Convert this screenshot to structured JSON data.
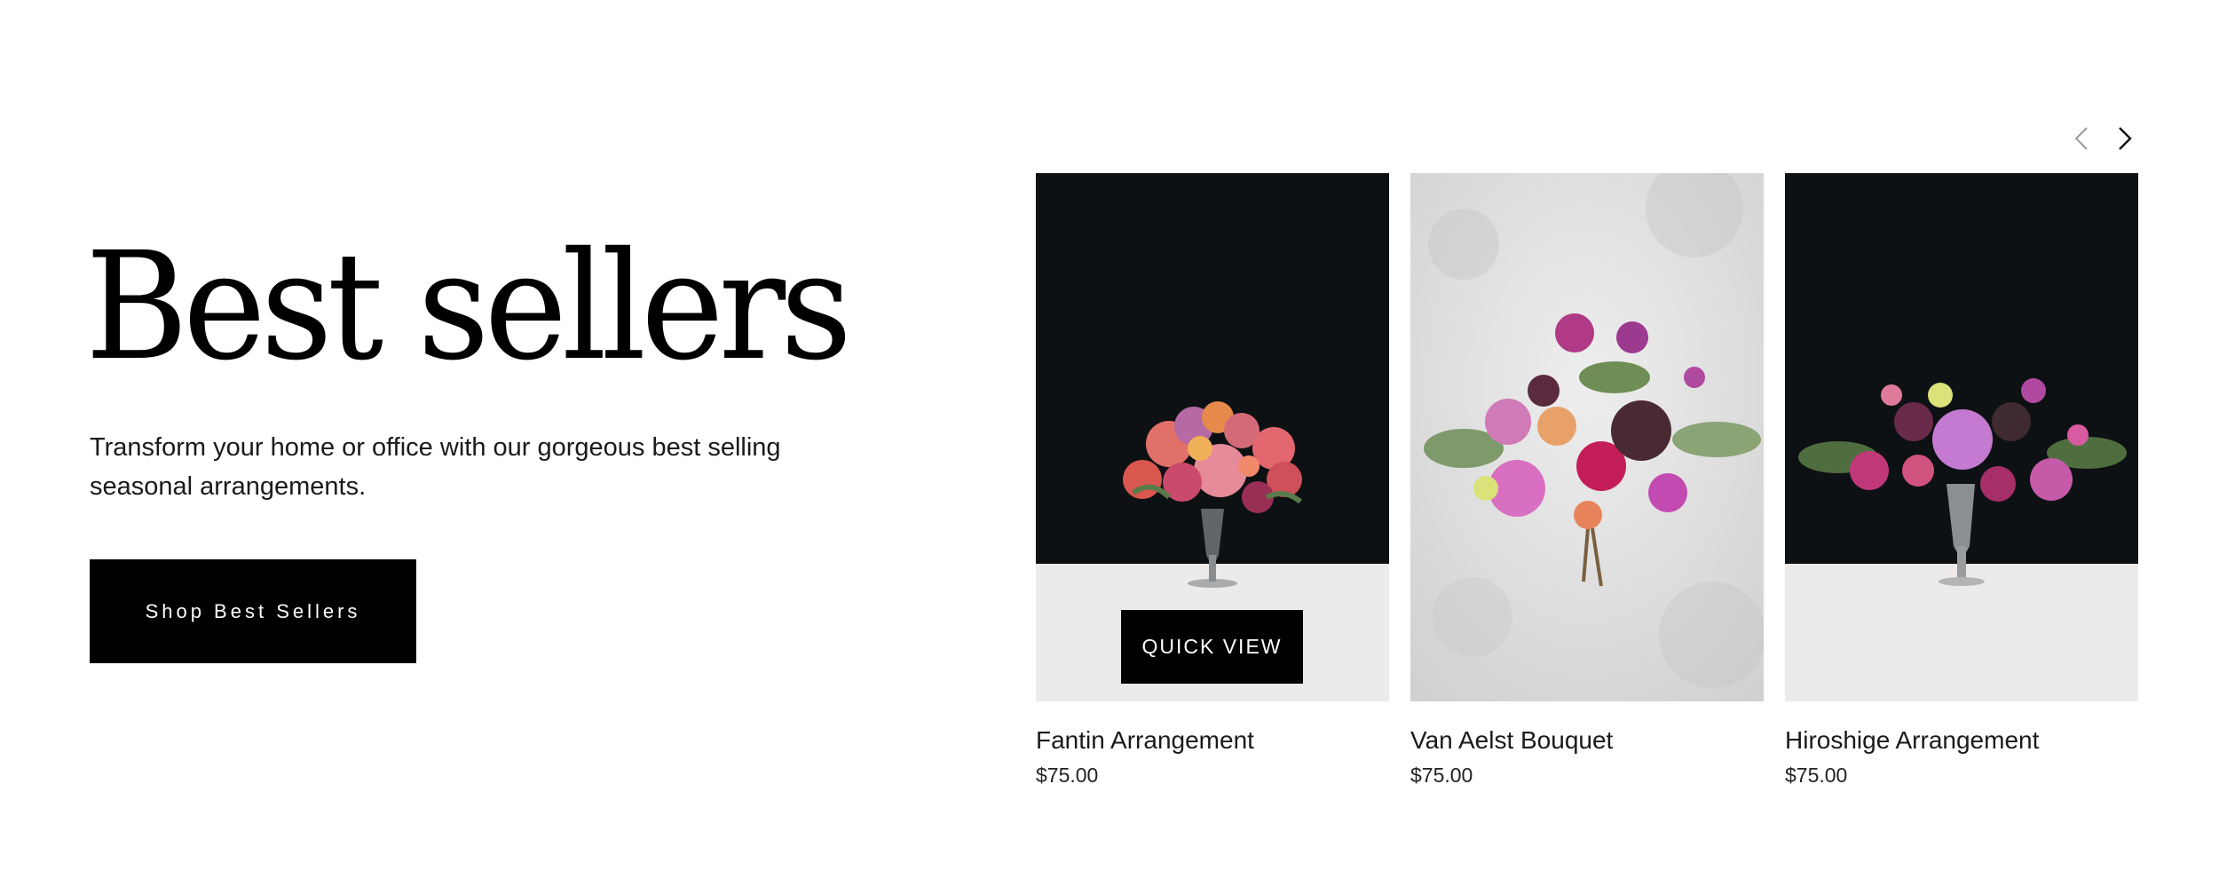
{
  "hero": {
    "title": "Best sellers",
    "description": "Transform your home or office with our gorgeous best selling seasonal arrangements.",
    "button_label": "Shop Best Sellers"
  },
  "carousel": {
    "prev_icon": "chevron-left-icon",
    "next_icon": "chevron-right-icon",
    "quick_view_label": "QUICK VIEW",
    "products": [
      {
        "name": "Fantin Arrangement",
        "price": "$75.00",
        "background": "#0e1114",
        "table": "#ecebe9"
      },
      {
        "name": "Van Aelst Bouquet",
        "price": "$75.00",
        "background": "#dcdcdc"
      },
      {
        "name": "Hiroshige Arrangement",
        "price": "$75.00",
        "background": "#0e1114",
        "table": "#ecebe9"
      }
    ]
  },
  "colors": {
    "button_bg": "#000000",
    "button_text": "#ffffff",
    "text": "#111111"
  }
}
